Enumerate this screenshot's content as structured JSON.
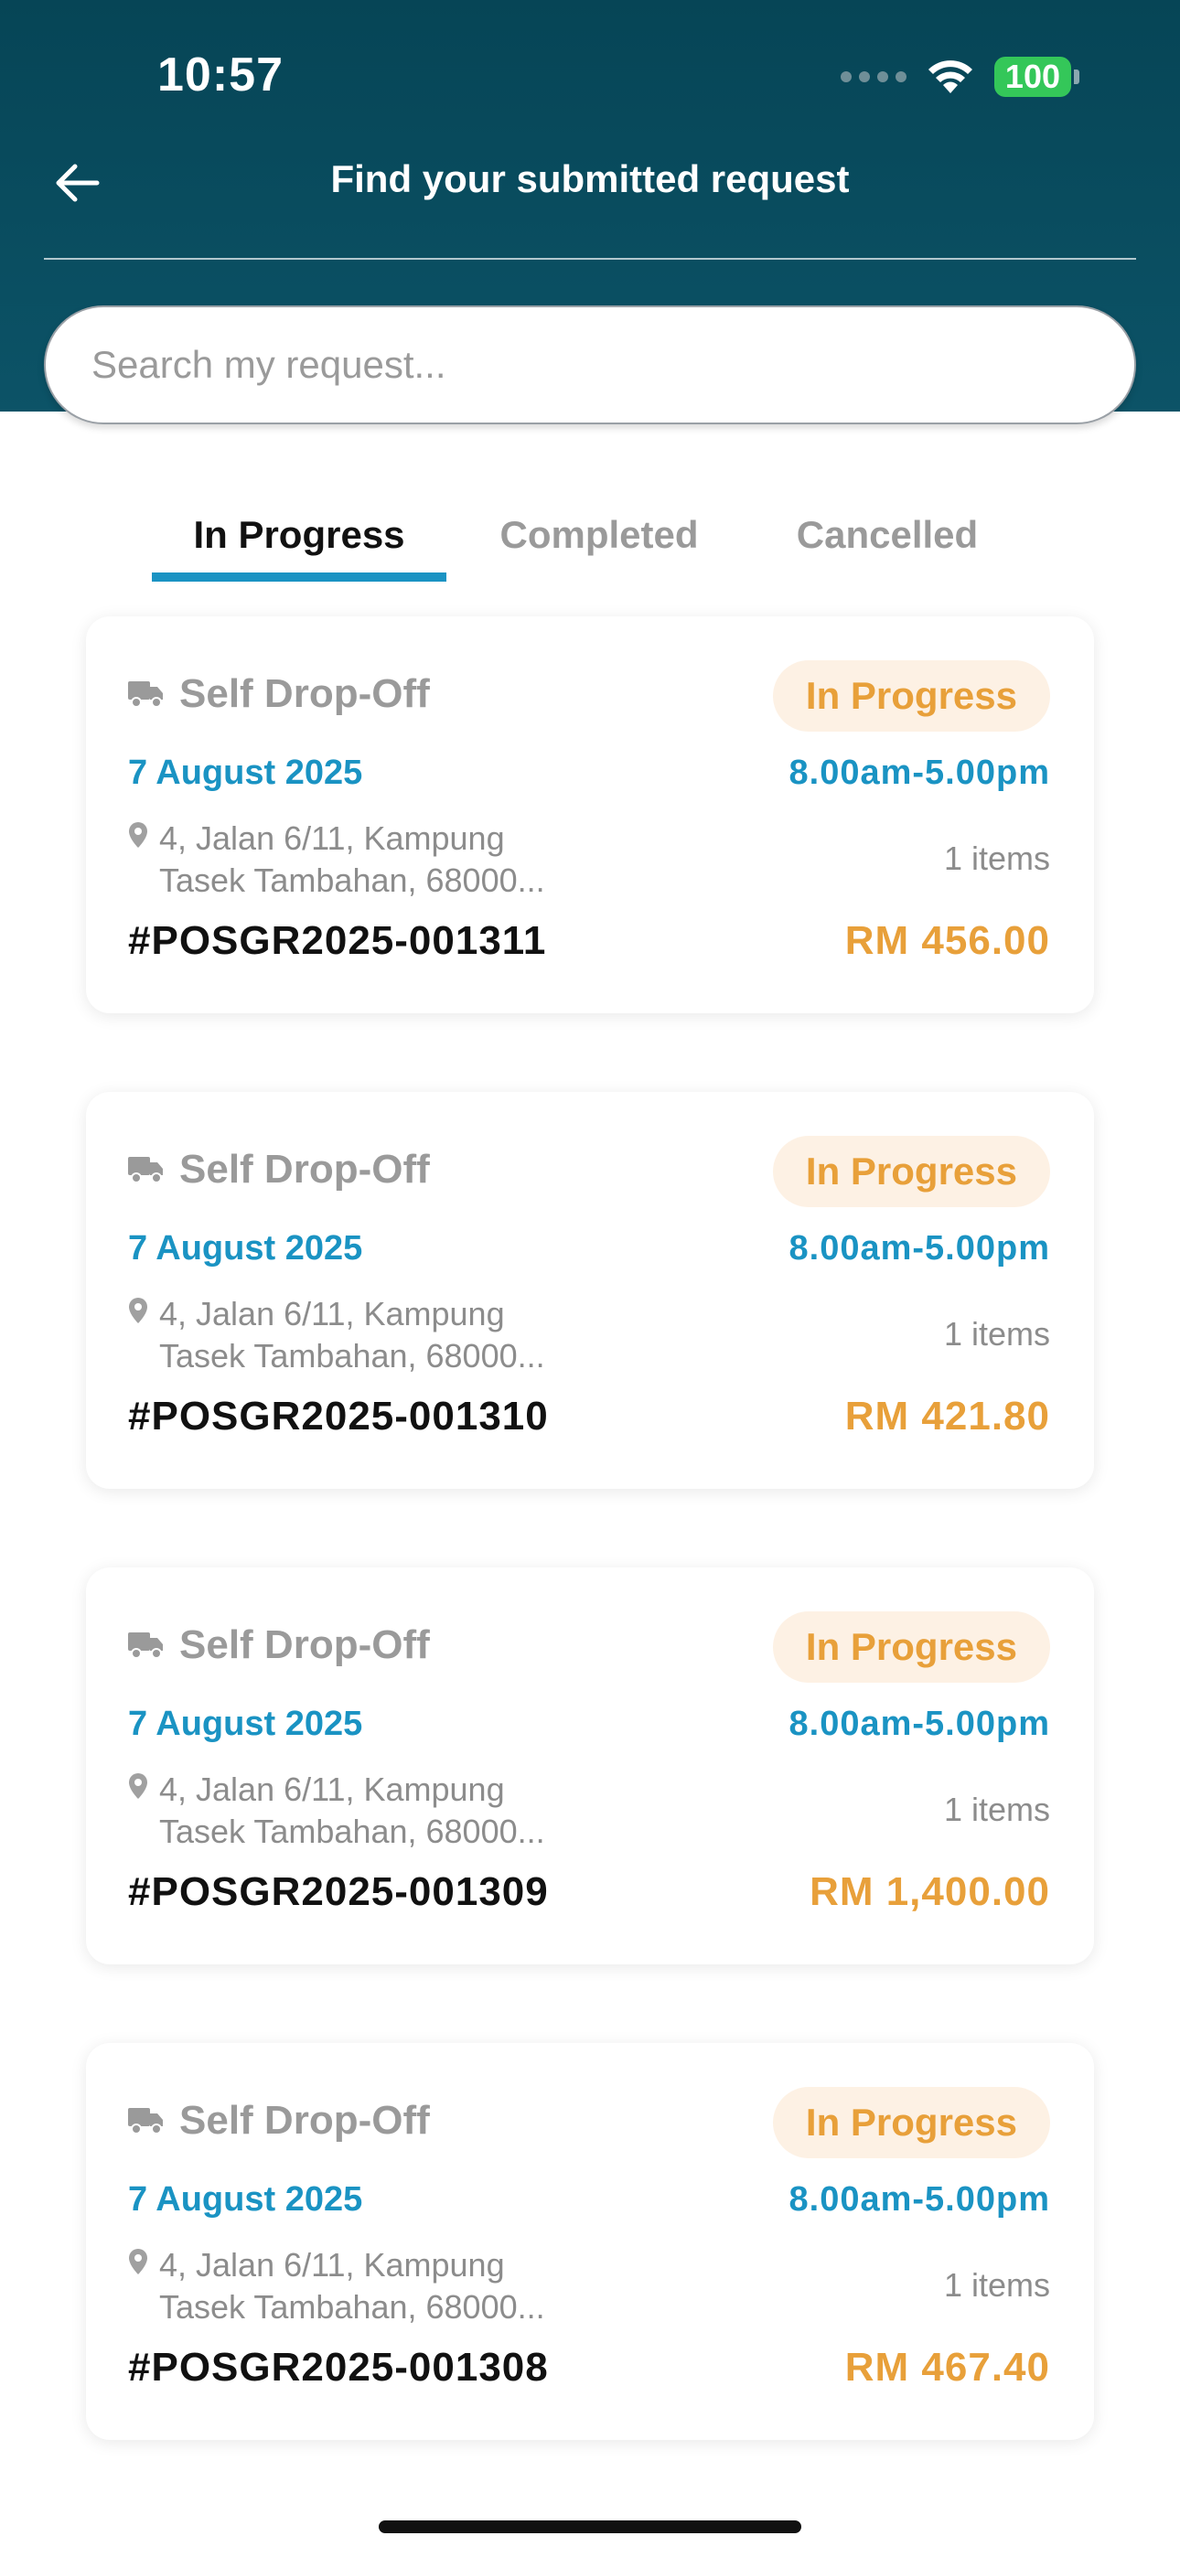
{
  "status_bar": {
    "time": "10:57",
    "battery": "100"
  },
  "header": {
    "title": "Find your submitted request",
    "search_placeholder": "Search my request..."
  },
  "tabs": [
    {
      "label": "In Progress"
    },
    {
      "label": "Completed"
    },
    {
      "label": "Cancelled"
    }
  ],
  "colors": {
    "accent": "#1a93c3",
    "status": "#e8a03a",
    "header": "#064556"
  },
  "requests": [
    {
      "method": "Self Drop-Off",
      "status": "In Progress",
      "date": "7 August 2025",
      "time": "8.00am-5.00pm",
      "address_line1": "4, Jalan 6/11, Kampung",
      "address_line2": "Tasek Tambahan, 68000...",
      "items": "1 items",
      "ref": "#POSGR2025-001311",
      "amount": "RM 456.00"
    },
    {
      "method": "Self Drop-Off",
      "status": "In Progress",
      "date": "7 August 2025",
      "time": "8.00am-5.00pm",
      "address_line1": "4, Jalan 6/11, Kampung",
      "address_line2": "Tasek Tambahan, 68000...",
      "items": "1 items",
      "ref": "#POSGR2025-001310",
      "amount": "RM 421.80"
    },
    {
      "method": "Self Drop-Off",
      "status": "In Progress",
      "date": "7 August 2025",
      "time": "8.00am-5.00pm",
      "address_line1": "4, Jalan 6/11, Kampung",
      "address_line2": "Tasek Tambahan, 68000...",
      "items": "1 items",
      "ref": "#POSGR2025-001309",
      "amount": "RM 1,400.00"
    },
    {
      "method": "Self Drop-Off",
      "status": "In Progress",
      "date": "7 August 2025",
      "time": "8.00am-5.00pm",
      "address_line1": "4, Jalan 6/11, Kampung",
      "address_line2": "Tasek Tambahan, 68000...",
      "items": "1 items",
      "ref": "#POSGR2025-001308",
      "amount": "RM 467.40"
    }
  ]
}
